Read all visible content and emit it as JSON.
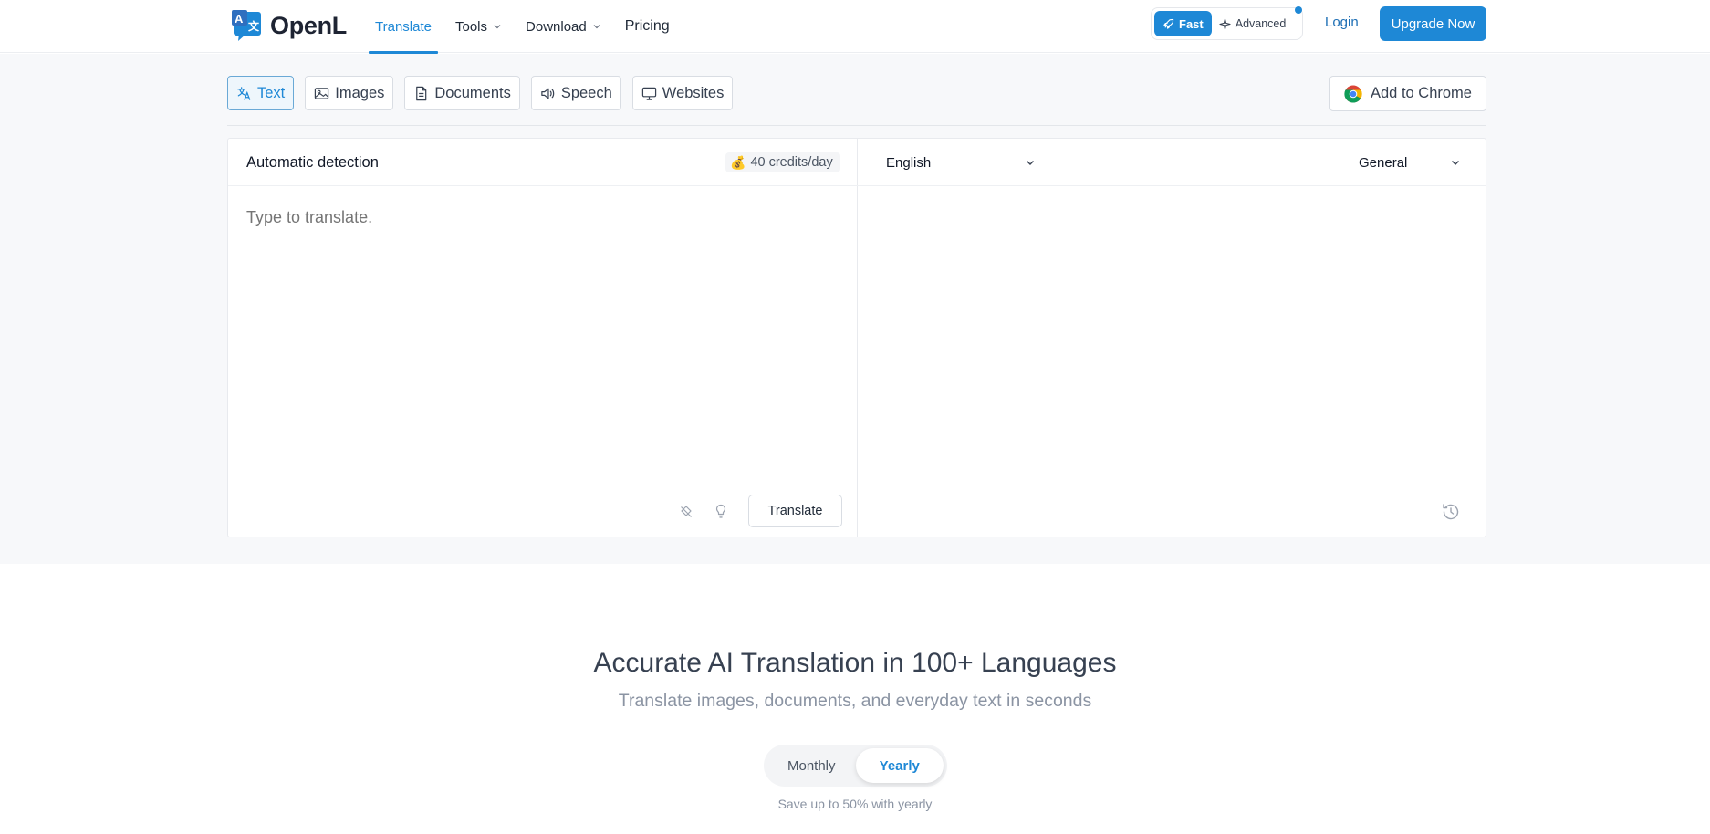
{
  "header": {
    "logo_text": "OpenL",
    "nav": [
      {
        "label": "Translate",
        "active": true,
        "dropdown": false
      },
      {
        "label": "Tools",
        "active": false,
        "dropdown": true
      },
      {
        "label": "Download",
        "active": false,
        "dropdown": true
      },
      {
        "label": "Pricing",
        "active": false,
        "dropdown": false
      }
    ],
    "mode": {
      "fast_label": "Fast",
      "advanced_label": "Advanced",
      "selected": "Fast"
    },
    "login_label": "Login",
    "upgrade_label": "Upgrade Now"
  },
  "tabs": [
    {
      "label": "Text",
      "icon": "translate-icon",
      "active": true
    },
    {
      "label": "Images",
      "icon": "image-icon",
      "active": false
    },
    {
      "label": "Documents",
      "icon": "document-icon",
      "active": false
    },
    {
      "label": "Speech",
      "icon": "speaker-icon",
      "active": false
    },
    {
      "label": "Websites",
      "icon": "monitor-icon",
      "active": false
    }
  ],
  "add_to_chrome_label": "Add to Chrome",
  "source": {
    "language": "Automatic detection",
    "credits": "40 credits/day",
    "placeholder": "Type to translate.",
    "translate_label": "Translate"
  },
  "target": {
    "language": "English",
    "domain": "General"
  },
  "hero": {
    "title": "Accurate AI Translation in 100+ Languages",
    "subtitle": "Translate images, documents, and everyday text in seconds"
  },
  "billing": {
    "monthly_label": "Monthly",
    "yearly_label": "Yearly",
    "selected": "Yearly",
    "note": "Save up to 50% with yearly"
  },
  "colors": {
    "accent": "#1e88d6",
    "background": "#f7f8fa"
  }
}
